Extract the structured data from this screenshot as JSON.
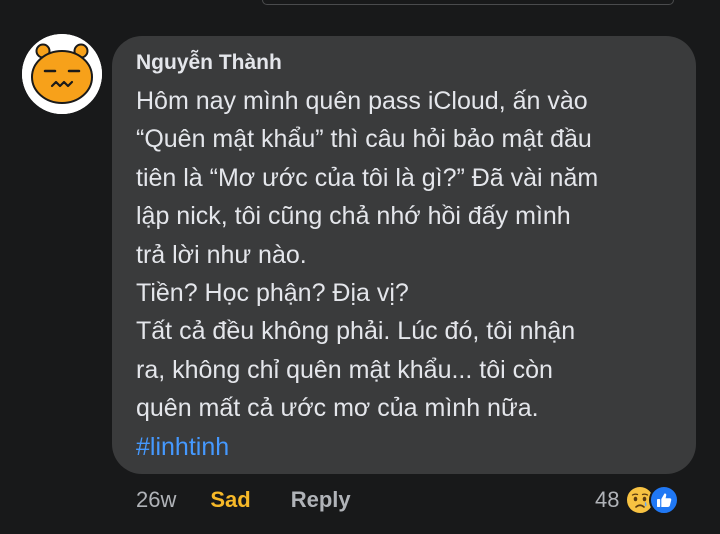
{
  "comment": {
    "author": "Nguyễn Thành",
    "lines": [
      "Hôm nay mình quên pass iCloud, ấn vào",
      "“Quên mật khẩu” thì câu hỏi bảo mật đầu",
      "tiên là “Mơ ước của tôi là gì?” Đã vài năm",
      "lập nick, tôi cũng chả nhớ hồi đấy mình",
      "trả lời như nào.",
      "Tiền? Học phận? Địa vị?",
      "Tất cả đều không phải. Lúc đó, tôi nhận",
      "ra, không chỉ quên mật khẩu... tôi còn",
      "quên mất cả ước mơ của mình nữa."
    ],
    "hashtag": "#linhtinh"
  },
  "actions": {
    "timestamp": "26w",
    "reaction_label": "Sad",
    "reply_label": "Reply"
  },
  "reactions": {
    "count": "48",
    "icons": [
      "sad-emoji-icon",
      "like-icon"
    ]
  },
  "colors": {
    "background": "#18191a",
    "bubble": "#3a3b3c",
    "text": "#e4e6eb",
    "muted": "#b0b3b8",
    "sad_accent": "#f7b928",
    "hashtag": "#4599ff"
  }
}
